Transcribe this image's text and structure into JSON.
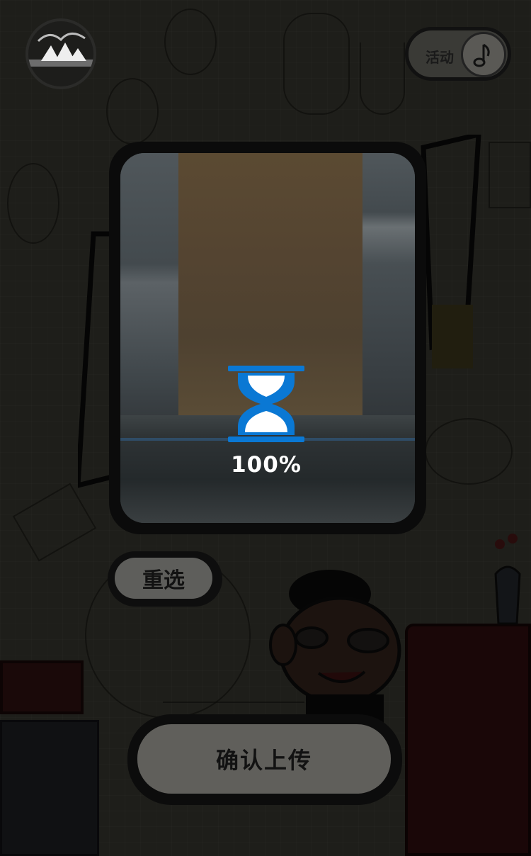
{
  "activity": {
    "label": "活动"
  },
  "upload": {
    "progress_text": "100%",
    "progress": 1.0
  },
  "buttons": {
    "reselect": "重选",
    "confirm": "确认上传"
  },
  "colors": {
    "hourglass": "#0a78d4",
    "overlay": "#000000"
  },
  "icons": [
    "avatar-icon",
    "music-note-icon",
    "hourglass-icon"
  ]
}
